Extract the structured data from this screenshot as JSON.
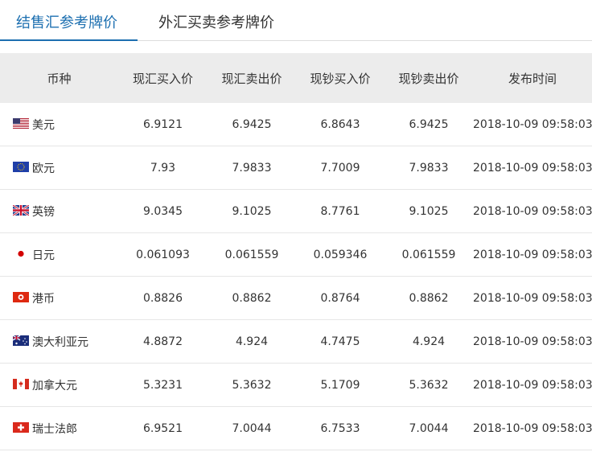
{
  "tabs": [
    {
      "label": "结售汇参考牌价",
      "active": true
    },
    {
      "label": "外汇买卖参考牌价",
      "active": false
    }
  ],
  "columns": [
    "币种",
    "现汇买入价",
    "现汇卖出价",
    "现钞买入价",
    "现钞卖出价",
    "发布时间"
  ],
  "rows": [
    {
      "flag": "us-flag-icon",
      "name": "美元",
      "spot_buy": "6.9121",
      "spot_sell": "6.9425",
      "cash_buy": "6.8643",
      "cash_sell": "6.9425",
      "time": "2018-10-09 09:58:03"
    },
    {
      "flag": "eu-flag-icon",
      "name": "欧元",
      "spot_buy": "7.93",
      "spot_sell": "7.9833",
      "cash_buy": "7.7009",
      "cash_sell": "7.9833",
      "time": "2018-10-09 09:58:03"
    },
    {
      "flag": "uk-flag-icon",
      "name": "英镑",
      "spot_buy": "9.0345",
      "spot_sell": "9.1025",
      "cash_buy": "8.7761",
      "cash_sell": "9.1025",
      "time": "2018-10-09 09:58:03"
    },
    {
      "flag": "jp-flag-icon",
      "name": "日元",
      "spot_buy": "0.061093",
      "spot_sell": "0.061559",
      "cash_buy": "0.059346",
      "cash_sell": "0.061559",
      "time": "2018-10-09 09:58:03"
    },
    {
      "flag": "hk-flag-icon",
      "name": "港币",
      "spot_buy": "0.8826",
      "spot_sell": "0.8862",
      "cash_buy": "0.8764",
      "cash_sell": "0.8862",
      "time": "2018-10-09 09:58:03"
    },
    {
      "flag": "au-flag-icon",
      "name": "澳大利亚元",
      "spot_buy": "4.8872",
      "spot_sell": "4.924",
      "cash_buy": "4.7475",
      "cash_sell": "4.924",
      "time": "2018-10-09 09:58:03"
    },
    {
      "flag": "ca-flag-icon",
      "name": "加拿大元",
      "spot_buy": "5.3231",
      "spot_sell": "5.3632",
      "cash_buy": "5.1709",
      "cash_sell": "5.3632",
      "time": "2018-10-09 09:58:03"
    },
    {
      "flag": "ch-flag-icon",
      "name": "瑞士法郎",
      "spot_buy": "6.9521",
      "spot_sell": "7.0044",
      "cash_buy": "6.7533",
      "cash_sell": "7.0044",
      "time": "2018-10-09 09:58:03"
    }
  ],
  "colors": {
    "accent": "#1c6fb0",
    "header_bg": "#ececec",
    "row_border": "#e6e6e6"
  }
}
